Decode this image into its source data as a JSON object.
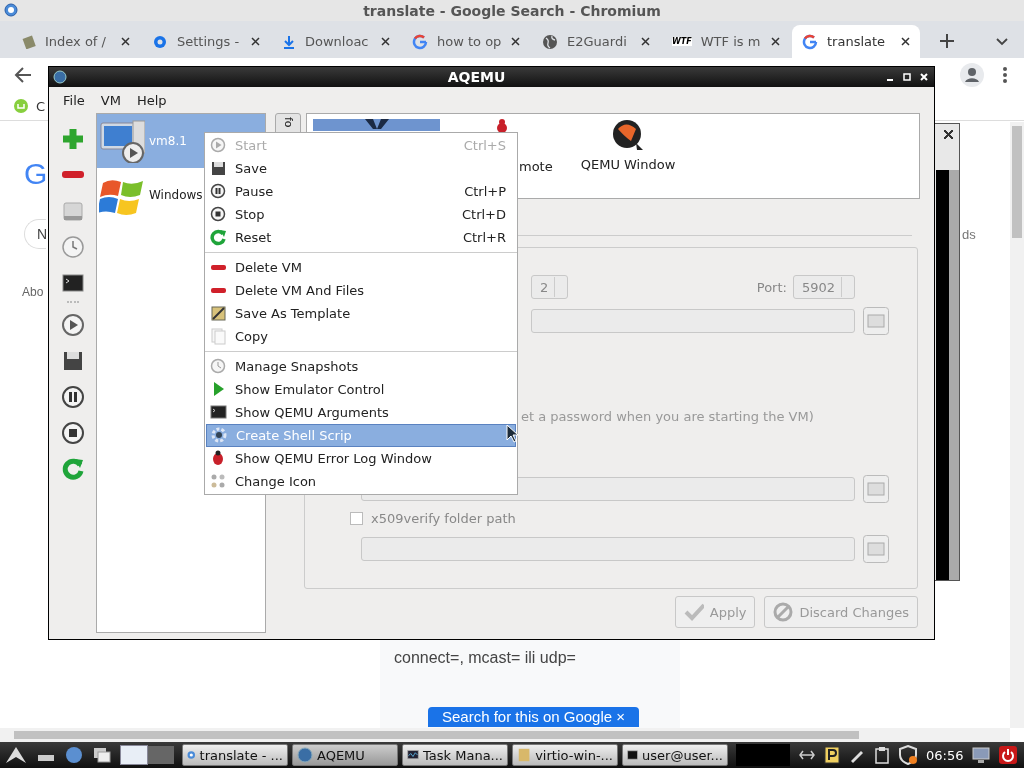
{
  "browser": {
    "title": "translate - Google Search - Chromium",
    "tabs": [
      {
        "label": "Index of /",
        "selected": false
      },
      {
        "label": "Settings -",
        "selected": false
      },
      {
        "label": "Downloac",
        "selected": false
      },
      {
        "label": "how to op",
        "selected": false
      },
      {
        "label": "E2Guardi",
        "selected": false
      },
      {
        "badge": "WTF",
        "label": "WTF is m",
        "selected": false
      },
      {
        "label": "translate",
        "selected": true
      }
    ],
    "bookmark": "C",
    "page": {
      "logo_fragment": "G",
      "chip_fragment": "N",
      "about_fragment": "Abo",
      "side_fragment": "ds",
      "snippet": "connect=, mcast= ili udp=",
      "search_button": "Search for this on Google  ×"
    }
  },
  "aqemu": {
    "title": "AQEMU",
    "menu": [
      "File",
      "VM",
      "Help"
    ],
    "vms": [
      {
        "name": "vm8.1",
        "selected": true
      },
      {
        "name": "Windows",
        "selected": false
      }
    ],
    "side_tab": "fo",
    "views": [
      {
        "selected": true
      },
      {
        "label": "mote",
        "selected": false
      },
      {
        "label": "QEMU Window",
        "selected": false
      }
    ],
    "form": {
      "display_value": "2",
      "port_label": "Port:",
      "port_value": "5902",
      "password_note": "et a password when you are starting the VM)",
      "checkbox": {
        "label": "x509verify folder path",
        "checked": false
      }
    },
    "buttons": [
      {
        "label": "Apply",
        "disabled": true
      },
      {
        "label": "Discard Changes",
        "disabled": true
      }
    ]
  },
  "context_menu": {
    "sections": [
      {
        "items": [
          {
            "label": "Start",
            "shortcut": "Ctrl+S",
            "disabled": true,
            "selected": false
          },
          {
            "label": "Save",
            "disabled": false,
            "selected": false
          },
          {
            "label": "Pause",
            "shortcut": "Ctrl+P",
            "disabled": false,
            "selected": false
          },
          {
            "label": "Stop",
            "shortcut": "Ctrl+D",
            "disabled": false,
            "selected": false
          },
          {
            "label": "Reset",
            "shortcut": "Ctrl+R",
            "disabled": false,
            "selected": false
          }
        ]
      },
      {
        "items": [
          {
            "label": "Delete VM",
            "disabled": false,
            "selected": false
          },
          {
            "label": "Delete VM And Files",
            "disabled": false,
            "selected": false
          },
          {
            "label": "Save As Template",
            "disabled": false,
            "selected": false
          },
          {
            "label": "Copy",
            "disabled": false,
            "selected": false
          }
        ]
      },
      {
        "items": [
          {
            "label": "Manage Snapshots",
            "disabled": false,
            "selected": false
          },
          {
            "label": "Show Emulator Control",
            "disabled": false,
            "selected": false
          },
          {
            "label": "Show QEMU Arguments",
            "disabled": false,
            "selected": false
          },
          {
            "label": "Create Shell Scrip",
            "disabled": false,
            "selected": true
          },
          {
            "label": "Show QEMU Error Log Window",
            "disabled": false,
            "selected": false
          },
          {
            "label": "Change Icon",
            "disabled": false,
            "selected": false
          }
        ]
      }
    ]
  },
  "taskbar": {
    "tasks": [
      {
        "label": "translate - ...",
        "selected": false
      },
      {
        "label": "AQEMU",
        "selected": true
      },
      {
        "label": "Task Mana...",
        "selected": false
      },
      {
        "label": "virtio-win-...",
        "selected": false
      },
      {
        "label": "user@user...",
        "selected": false
      }
    ],
    "clock": "06:56"
  }
}
